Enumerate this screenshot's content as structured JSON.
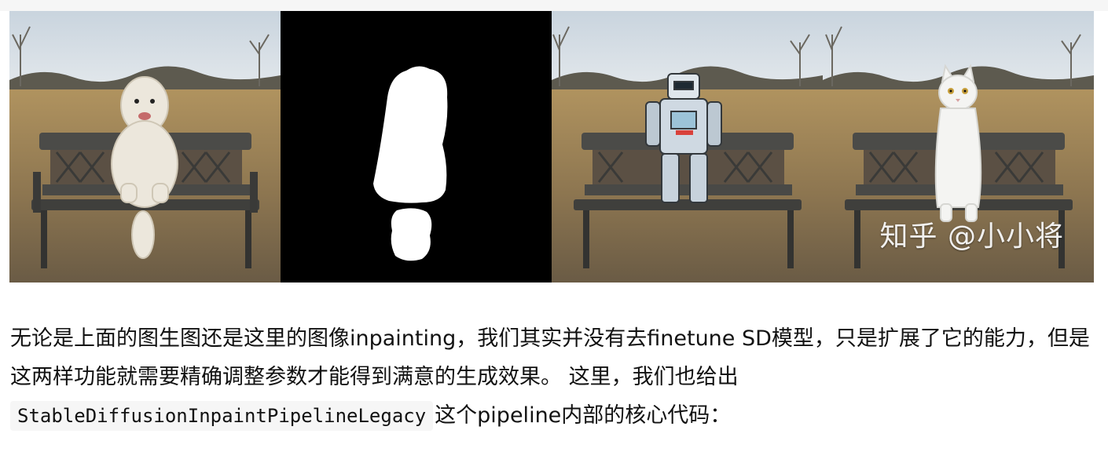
{
  "figure": {
    "panels": [
      {
        "name": "original-dog-photo",
        "subject": "dog"
      },
      {
        "name": "inpainting-mask",
        "subject": "mask"
      },
      {
        "name": "inpainted-robot-result",
        "subject": "robot"
      },
      {
        "name": "inpainted-cat-result",
        "subject": "cat"
      }
    ],
    "watermark": "知乎 @小小将"
  },
  "paragraph": {
    "text_before": "无论是上面的图生图还是这里的图像inpainting，我们其实并没有去finetune SD模型，只是扩展了它的能力，但是这两样功能就需要精确调整参数才能得到满意的生成效果。 这里，我们也给出",
    "code": "StableDiffusionInpaintPipelineLegacy",
    "text_after": "这个pipeline内部的核心代码："
  },
  "colors": {
    "text": "#121212",
    "code_background": "#f6f6f6",
    "sky": "#cfd9e2",
    "field": "#a68a5c",
    "bench": "#3d3d3b",
    "mask_bg": "#000000",
    "mask_fg": "#ffffff"
  }
}
